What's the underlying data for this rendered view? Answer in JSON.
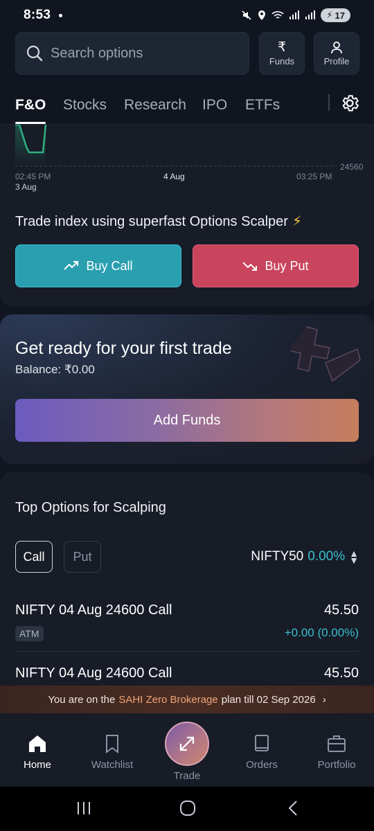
{
  "status_bar": {
    "time": "8:53",
    "battery": "17"
  },
  "search": {
    "placeholder": "Search options"
  },
  "header_buttons": {
    "funds_label": "Funds",
    "profile_label": "Profile"
  },
  "tabs": [
    {
      "label": "F&O",
      "active": true
    },
    {
      "label": "Stocks",
      "active": false
    },
    {
      "label": "Research",
      "active": false
    },
    {
      "label": "IPO",
      "active": false
    },
    {
      "label": "ETFs",
      "active": false
    }
  ],
  "chart": {
    "y_tick": "24560",
    "x_tick_left_time": "02:45 PM",
    "x_tick_left_date": "3 Aug",
    "x_tick_mid": "4 Aug",
    "x_tick_right": "03:25 PM",
    "line_color": "#2fb07f"
  },
  "trade_card": {
    "heading": "Trade index using superfast Options Scalper",
    "buy_call_label": "Buy Call",
    "buy_put_label": "Buy Put"
  },
  "funds_card": {
    "title": "Get ready for your first trade",
    "balance": "Balance: ₹0.00",
    "add_funds_label": "Add Funds"
  },
  "scalping": {
    "title": "Top Options for Scalping",
    "chip_call": "Call",
    "chip_put": "Put",
    "index_name": "NIFTY50",
    "index_change": "0.00%",
    "rows": [
      {
        "name": "NIFTY 04 Aug 24600 Call",
        "badge": "ATM",
        "price": "45.50",
        "change": "+0.00 (0.00%)"
      },
      {
        "name": "NIFTY 04 Aug 24600 Call",
        "price": "45.50"
      }
    ]
  },
  "promo": {
    "prefix": "You are on the",
    "plan": "SAHI Zero Brokerage",
    "suffix": "plan till 02 Sep 2026"
  },
  "bottom_nav": [
    {
      "label": "Home",
      "icon": "home-icon",
      "active": true
    },
    {
      "label": "Watchlist",
      "icon": "bookmark-icon",
      "active": false
    },
    {
      "label": "Trade",
      "icon": "trade-arrows-icon",
      "active": false
    },
    {
      "label": "Orders",
      "icon": "book-icon",
      "active": false
    },
    {
      "label": "Portfolio",
      "icon": "briefcase-icon",
      "active": false
    }
  ],
  "colors": {
    "accent_teal": "#3bbecf",
    "call_button": "#2a9fb0",
    "put_button": "#c9445d",
    "promo_highlight": "#f0a477"
  }
}
